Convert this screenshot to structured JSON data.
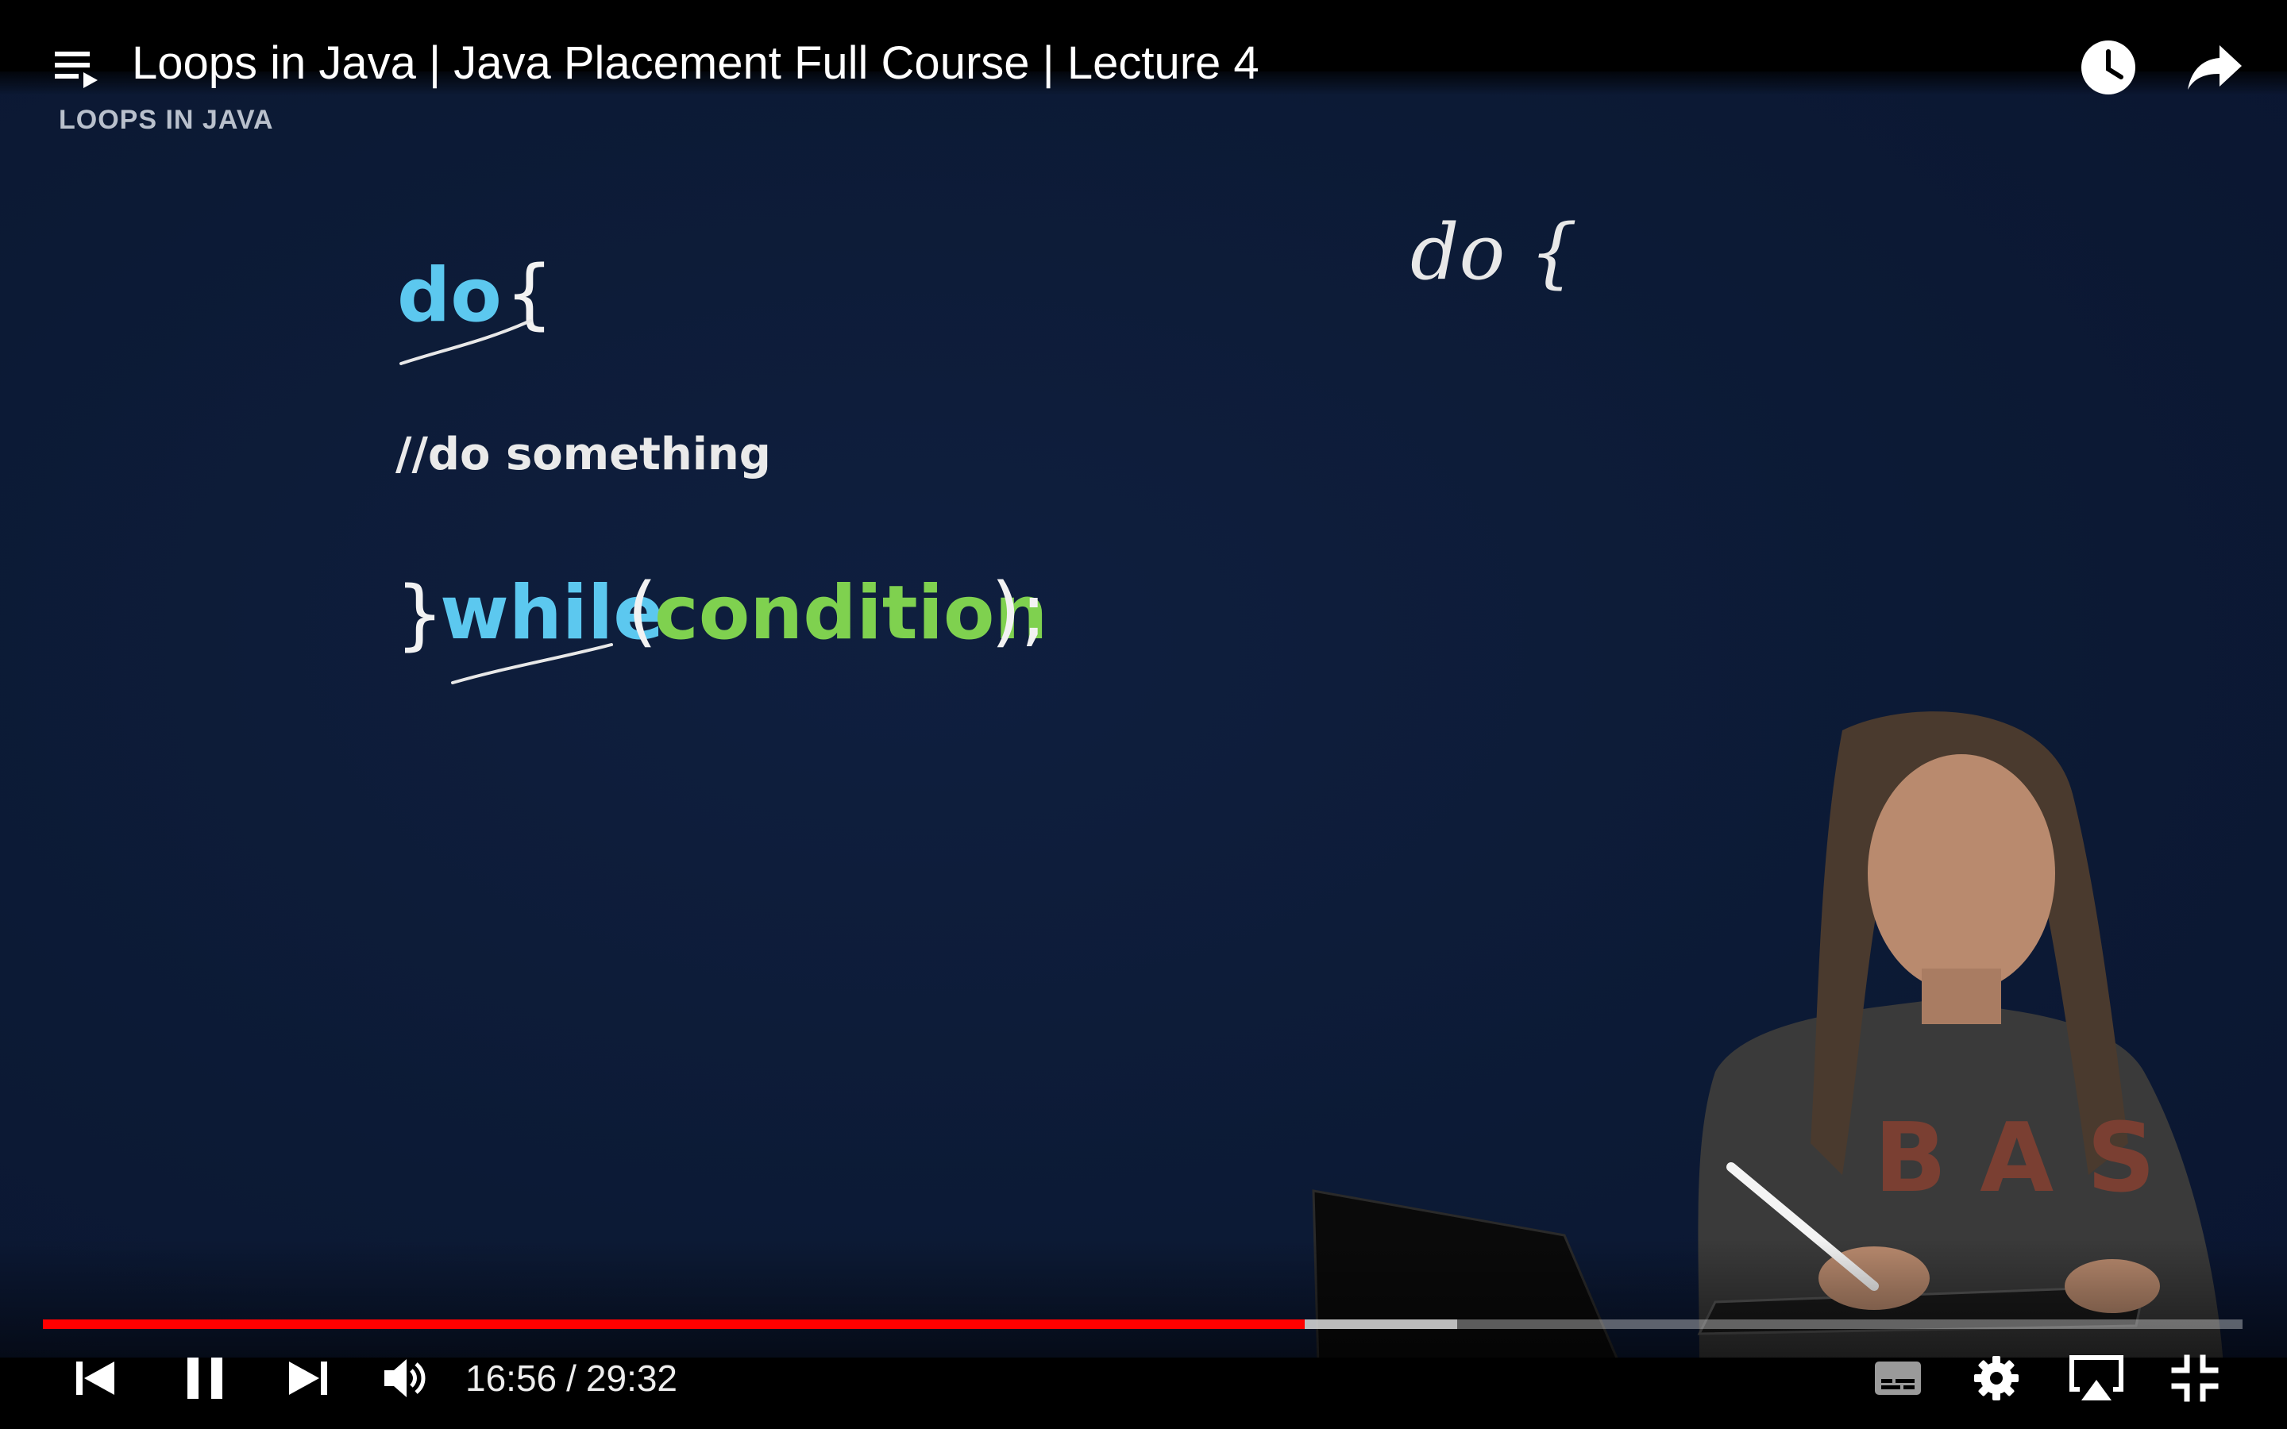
{
  "video": {
    "title": "Loops in Java | Java Placement Full Course | Lecture 4",
    "slide_label": "LOOPS IN JAVA",
    "code": {
      "kw_do": "do",
      "brace_open": "{",
      "comment": "//do something",
      "brace_close": "}",
      "kw_while": "while",
      "paren_open": "(",
      "condition": "condition",
      "paren_close": ");"
    },
    "handwriting": "do {"
  },
  "playback": {
    "current_time": "16:56",
    "separator": "/",
    "duration": "29:32",
    "played_fraction": 0.5735,
    "buffered_fraction": 0.643
  },
  "colors": {
    "progress_played": "#ff0000",
    "keyword": "#5cc8ef",
    "condition": "#7fd14f"
  },
  "icons": {
    "playlist": "playlist-icon",
    "watch_later": "clock-icon",
    "share": "share-arrow-icon",
    "prev": "skip-previous-icon",
    "pause": "pause-icon",
    "next": "skip-next-icon",
    "volume": "volume-icon",
    "captions": "captions-icon",
    "settings": "gear-icon",
    "airplay": "airplay-icon",
    "exit_fullscreen": "exit-fullscreen-icon"
  }
}
